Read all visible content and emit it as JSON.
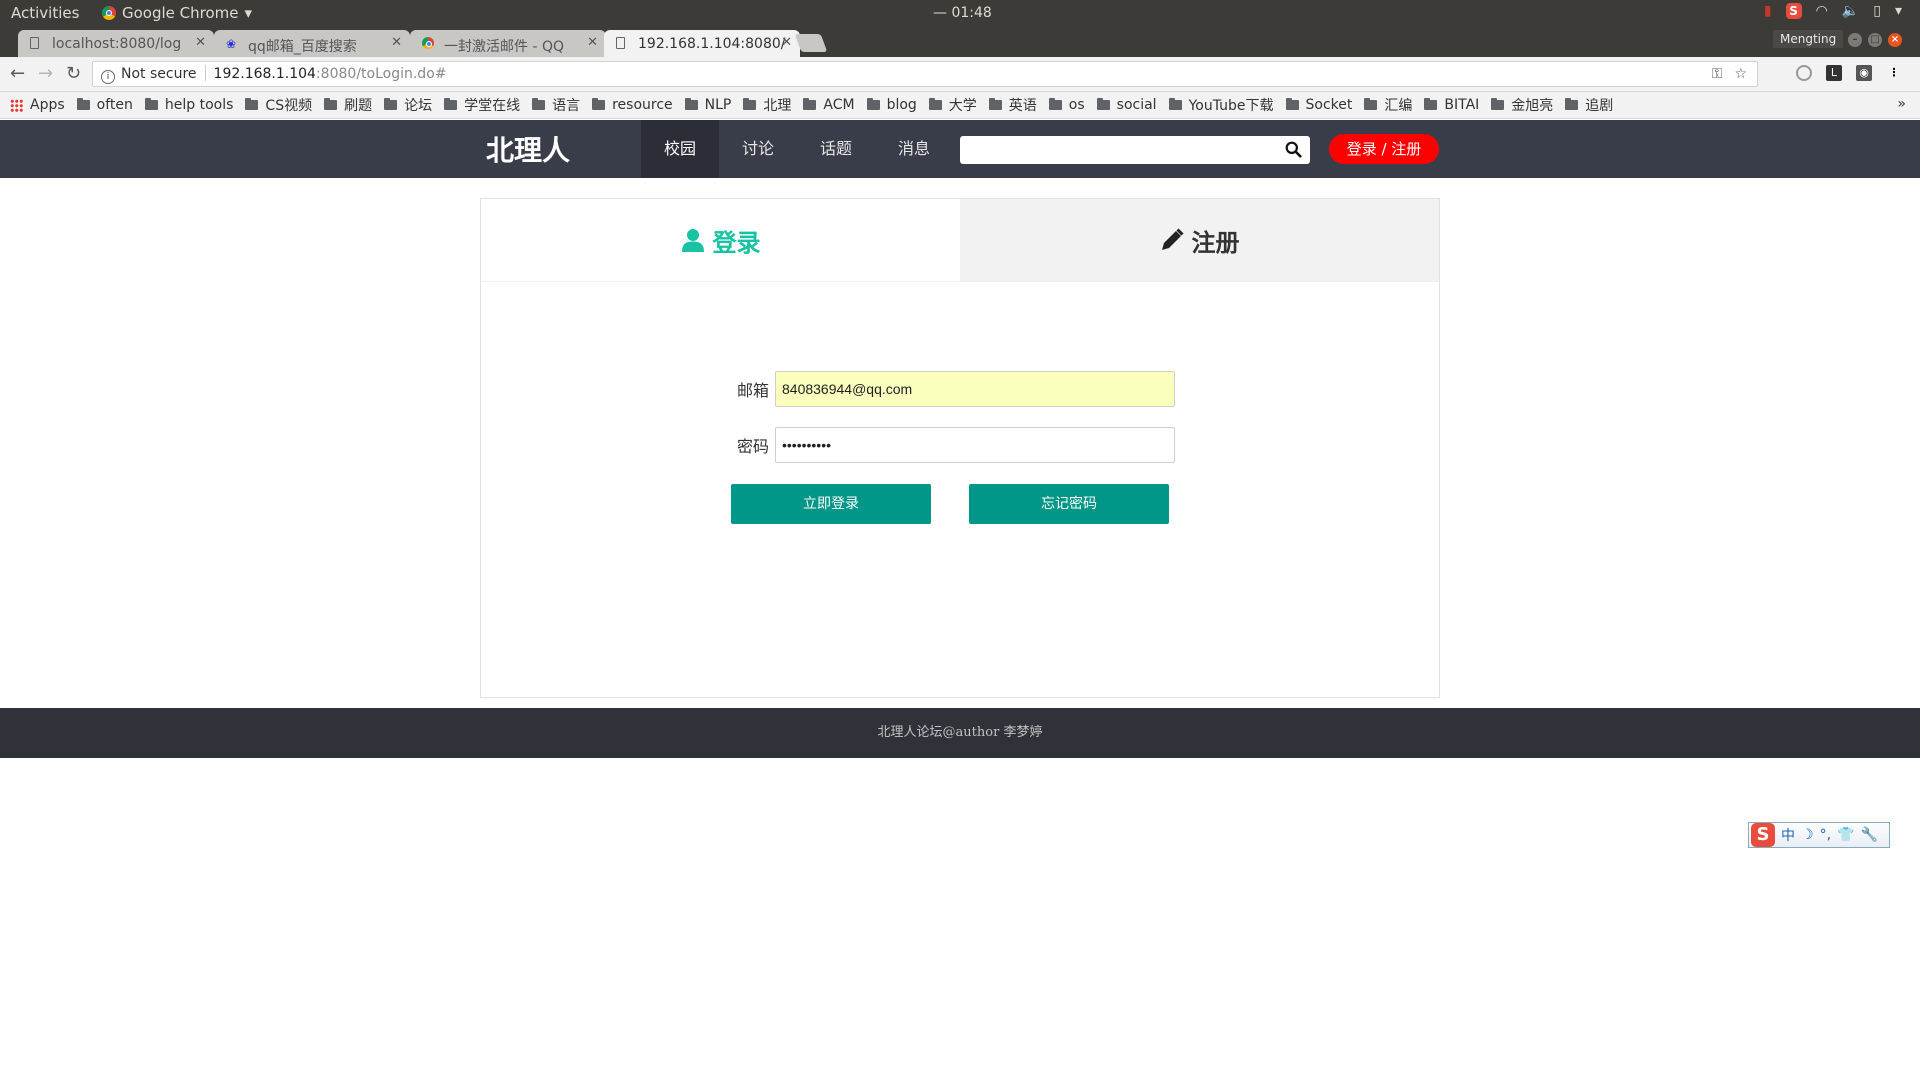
{
  "os": {
    "activities": "Activities",
    "app_name": "Google Chrome",
    "clock": "— 01:48",
    "tray_user": "Mengting"
  },
  "browser": {
    "tabs": [
      {
        "label": "localhost:8080/log",
        "icon": "document-icon"
      },
      {
        "label": "qq邮箱_百度搜索",
        "icon": "baidu-paw-icon"
      },
      {
        "label": "一封激活邮件 - QQ",
        "icon": "chrome-icon"
      },
      {
        "label": "192.168.1.104:8080/",
        "icon": "document-icon"
      }
    ],
    "active_tab": 3,
    "security": "Not secure",
    "url_host": "192.168.1.104",
    "url_path": ":8080/toLogin.do#",
    "bookmarks": [
      "often",
      "help tools",
      "CS视频",
      "刷题",
      "论坛",
      "学堂在线",
      "语言",
      "resource",
      "NLP",
      "北理",
      "ACM",
      "blog",
      "大学",
      "英语",
      "os",
      "social",
      "YouTube下载",
      "Socket",
      "汇编",
      "BITAI",
      "金旭亮",
      "追剧"
    ],
    "apps_label": "Apps",
    "more": "»"
  },
  "site": {
    "brand": "北理人",
    "nav": [
      "校园",
      "讨论",
      "话题",
      "消息"
    ],
    "active_nav": 0,
    "search_value": "",
    "login_register": "登录 / 注册",
    "footer": "北理人论坛@author 李梦婷"
  },
  "auth": {
    "tab_login": "登录",
    "tab_register": "注册",
    "email_label": "邮箱",
    "email_value": "840836944@qq.com",
    "password_label": "密码",
    "password_value": "••••••••••",
    "login_button": "立即登录",
    "forgot_button": "忘记密码"
  },
  "ime": {
    "mode": "中"
  },
  "colors": {
    "header_bg": "#393d49",
    "accent_green": "#17c3a2",
    "button_teal": "#009688",
    "login_pill_red": "#ff0000"
  }
}
